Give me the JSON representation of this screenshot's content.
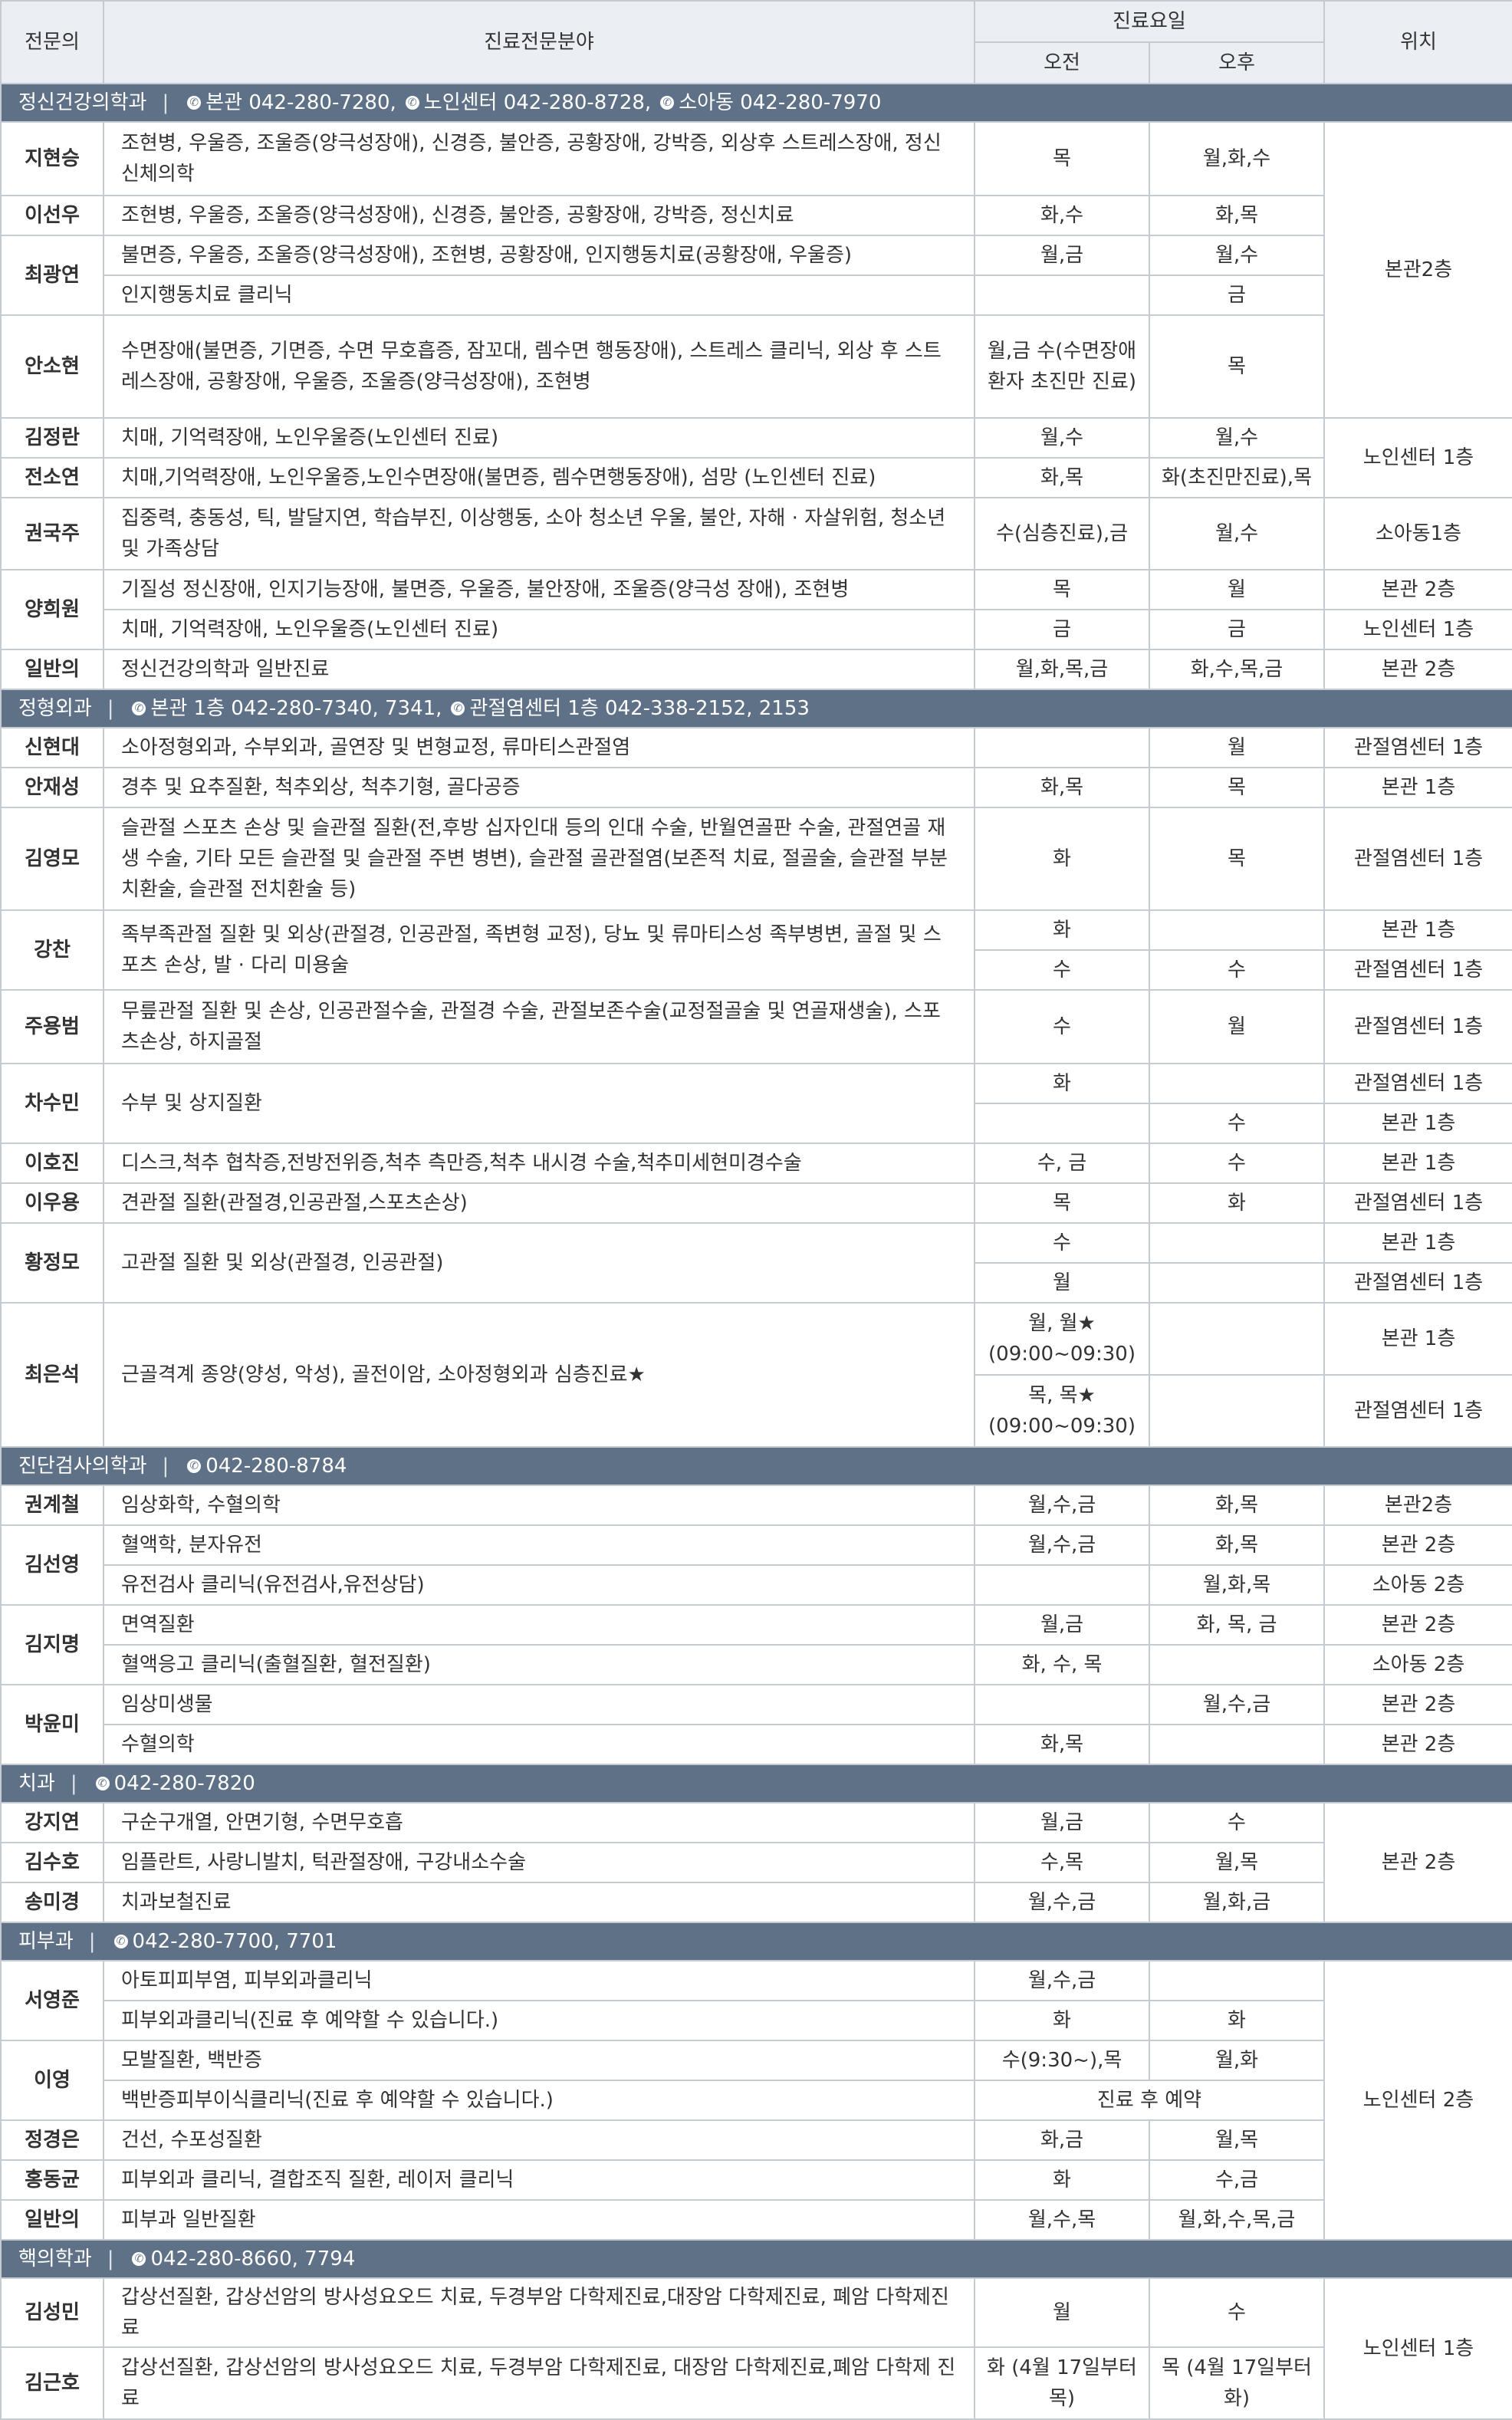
{
  "header": {
    "doctor": "전문의",
    "area": "진료전문분야",
    "days": "진료요일",
    "am": "오전",
    "pm": "오후",
    "location": "위치"
  },
  "sections": [
    {
      "name": "정신건강의학과",
      "phones": [
        "본관 042-280-7280,",
        "노인센터 042-280-8728,",
        "소아동 042-280-7970"
      ],
      "rows": [
        {
          "doctor": "지현승",
          "area": "조현병, 우울증, 조울증(양극성장애), 신경증, 불안증, 공황장애, 강박증, 외상후 스트레스장애, 정신신체의학",
          "am": "목",
          "pm": "월,화,수",
          "location": "본관2층"
        },
        {
          "doctor": "이선우",
          "area": "조현병, 우울증, 조울증(양극성장애), 신경증, 불안증, 공황장애, 강박증, 정신치료",
          "am": "화,수",
          "pm": "화,목"
        },
        {
          "doctor": "최광연",
          "area": "불면증, 우울증, 조울증(양극성장애), 조현병, 공황장애, 인지행동치료(공황장애, 우울증)",
          "am": "월,금",
          "pm": "월,수"
        },
        {
          "area": "인지행동치료 클리닉",
          "am": "",
          "pm": "금"
        },
        {
          "doctor": "안소현",
          "area": "수면장애(불면증, 기면증, 수면 무호흡증, 잠꼬대, 렘수면 행동장애), 스트레스 클리닉, 외상 후 스트레스장애, 공황장애, 우울증, 조울증(양극성장애), 조현병",
          "am": "월,금 수(수면장애환자 초진만 진료)",
          "pm": "목"
        },
        {
          "doctor": "김정란",
          "area": "치매, 기억력장애, 노인우울증(노인센터 진료)",
          "am": "월,수",
          "pm": "월,수",
          "location": "노인센터 1층"
        },
        {
          "doctor": "전소연",
          "area": "치매,기억력장애, 노인우울증,노인수면장애(불면증, 렘수면행동장애), 섬망 (노인센터 진료)",
          "am": "화,목",
          "pm": "화(초진만진료),목"
        },
        {
          "doctor": "권국주",
          "area": "집중력, 충동성, 틱, 발달지연, 학습부진, 이상행동, 소아 청소년 우울, 불안, 자해 · 자살위험, 청소년 및 가족상담",
          "am": "수(심층진료),금",
          "pm": "월,수",
          "location": "소아동1층"
        },
        {
          "doctor": "양희원",
          "area": "기질성 정신장애, 인지기능장애, 불면증, 우울증, 불안장애, 조울증(양극성 장애), 조현병",
          "am": "목",
          "pm": "월",
          "location": "본관 2층"
        },
        {
          "area": "치매, 기억력장애, 노인우울증(노인센터 진료)",
          "am": "금",
          "pm": "금",
          "location": "노인센터 1층"
        },
        {
          "doctor": "일반의",
          "area": "정신건강의학과 일반진료",
          "am": "월,화,목,금",
          "pm": "화,수,목,금",
          "location": "본관 2층"
        }
      ]
    },
    {
      "name": "정형외과",
      "phones": [
        "본관 1층 042-280-7340, 7341,",
        "관절염센터 1층 042-338-2152, 2153"
      ],
      "rows": [
        {
          "doctor": "신현대",
          "area": "소아정형외과, 수부외과, 골연장 및 변형교정, 류마티스관절염",
          "am": "",
          "pm": "월",
          "location": "관절염센터 1층"
        },
        {
          "doctor": "안재성",
          "area": "경추 및 요추질환, 척추외상, 척추기형, 골다공증",
          "am": "화,목",
          "pm": "목",
          "location": "본관 1층"
        },
        {
          "doctor": "김영모",
          "area": "슬관절 스포츠 손상 및 슬관절 질환(전,후방 십자인대 등의 인대 수술, 반월연골판 수술, 관절연골 재생 수술, 기타 모든 슬관절 및 슬관절 주변 병변), 슬관절 골관절염(보존적 치료, 절골술, 슬관절 부분치환술, 슬관절 전치환술 등)",
          "am": "화",
          "pm": "목",
          "location": "관절염센터 1층"
        },
        {
          "doctor": "강찬",
          "area": "족부족관절 질환 및 외상(관절경, 인공관절, 족변형 교정), 당뇨 및 류마티스성 족부병변, 골절 및 스포츠 손상, 발 · 다리 미용술",
          "am": "화",
          "pm": "",
          "location": "본관 1층"
        },
        {
          "am": "수",
          "pm": "수",
          "location": "관절염센터 1층"
        },
        {
          "doctor": "주용범",
          "area": "무릎관절 질환 및 손상, 인공관절수술, 관절경 수술, 관절보존수술(교정절골술 및 연골재생술), 스포츠손상, 하지골절",
          "am": "수",
          "pm": "월",
          "location": "관절염센터 1층"
        },
        {
          "doctor": "차수민",
          "area": "수부 및 상지질환",
          "am": "화",
          "pm": "",
          "location": "관절염센터 1층"
        },
        {
          "am": "",
          "pm": "수",
          "location": "본관 1층"
        },
        {
          "doctor": "이호진",
          "area": "디스크,척추 협착증,전방전위증,척추 측만증,척추 내시경 수술,척추미세현미경수술",
          "am": "수, 금",
          "pm": "수",
          "location": "본관 1층"
        },
        {
          "doctor": "이우용",
          "area": "견관절 질환(관절경,인공관절,스포츠손상)",
          "am": "목",
          "pm": "화",
          "location": "관절염센터 1층"
        },
        {
          "doctor": "황정모",
          "area": "고관절 질환 및 외상(관절경, 인공관절)",
          "am": "수",
          "pm": "",
          "location": "본관 1층"
        },
        {
          "am": "월",
          "pm": "",
          "location": "관절염센터 1층"
        },
        {
          "doctor": "최은석",
          "area": "근골격계 종양(양성, 악성), 골전이암, 소아정형외과 심층진료★",
          "am": "월, 월★ (09:00~09:30)",
          "pm": "",
          "location": "본관 1층"
        },
        {
          "am": "목, 목★ (09:00~09:30)",
          "pm": "",
          "location": "관절염센터 1층"
        }
      ]
    },
    {
      "name": "진단검사의학과",
      "phones": [
        "042-280-8784"
      ],
      "rows": [
        {
          "doctor": "권계철",
          "area": "임상화학, 수혈의학",
          "am": "월,수,금",
          "pm": "화,목",
          "location": "본관2층"
        },
        {
          "doctor": "김선영",
          "area": "혈액학, 분자유전",
          "am": "월,수,금",
          "pm": "화,목",
          "location": "본관 2층"
        },
        {
          "area": "유전검사 클리닉(유전검사,유전상담)",
          "am": "",
          "pm": "월,화,목",
          "location": "소아동 2층"
        },
        {
          "doctor": "김지명",
          "area": "면역질환",
          "am": "월,금",
          "pm": "화, 목, 금",
          "location": "본관 2층"
        },
        {
          "area": "혈액응고 클리닉(출혈질환, 혈전질환)",
          "am": "화, 수, 목",
          "pm": "",
          "location": "소아동 2층"
        },
        {
          "doctor": "박윤미",
          "area": "임상미생물",
          "am": "",
          "pm": "월,수,금",
          "location": "본관 2층"
        },
        {
          "area": "수혈의학",
          "am": "화,목",
          "pm": "",
          "location": "본관 2층"
        }
      ]
    },
    {
      "name": "치과",
      "phones": [
        "042-280-7820"
      ],
      "rows": [
        {
          "doctor": "강지연",
          "area": "구순구개열, 안면기형, 수면무호흡",
          "am": "월,금",
          "pm": "수",
          "location": "본관 2층"
        },
        {
          "doctor": "김수호",
          "area": "임플란트, 사랑니발치, 턱관절장애, 구강내소수술",
          "am": "수,목",
          "pm": "월,목"
        },
        {
          "doctor": "송미경",
          "area": "치과보철진료",
          "am": "월,수,금",
          "pm": "월,화,금"
        }
      ]
    },
    {
      "name": "피부과",
      "phones": [
        "042-280-7700, 7701"
      ],
      "rows": [
        {
          "doctor": "서영준",
          "area": "아토피피부염, 피부외과클리닉",
          "am": "월,수,금",
          "pm": "",
          "location": "노인센터 2층"
        },
        {
          "area": "피부외과클리닉(진료 후 예약할 수 있습니다.)",
          "am": "화",
          "pm": "화"
        },
        {
          "doctor": "이영",
          "area": "모발질환, 백반증",
          "am": "수(9:30~),목",
          "pm": "월,화"
        },
        {
          "area": "백반증피부이식클리닉(진료 후 예약할 수 있습니다.)",
          "span": "진료 후 예약"
        },
        {
          "doctor": "정경은",
          "area": "건선, 수포성질환",
          "am": "화,금",
          "pm": "월,목"
        },
        {
          "doctor": "홍동균",
          "area": "피부외과 클리닉, 결합조직 질환, 레이저 클리닉",
          "am": "화",
          "pm": "수,금"
        },
        {
          "doctor": "일반의",
          "area": "피부과 일반질환",
          "am": "월,수,목",
          "pm": "월,화,수,목,금"
        }
      ]
    },
    {
      "name": "핵의학과",
      "phones": [
        "042-280-8660, 7794"
      ],
      "rows": [
        {
          "doctor": "김성민",
          "area": "갑상선질환, 갑상선암의 방사성요오드 치료, 두경부암 다학제진료,대장암 다학제진료, 폐암 다학제진료",
          "am": "월",
          "pm": "수",
          "location": "노인센터 1층"
        },
        {
          "doctor": "김근호",
          "area": "갑상선질환, 갑상선암의 방사성요오드 치료, 두경부암 다학제진료, 대장암 다학제진료,폐암 다학제 진료",
          "am": "화 (4월 17일부터 목)",
          "pm": "목 (4월 17일부터 화)"
        }
      ]
    }
  ]
}
